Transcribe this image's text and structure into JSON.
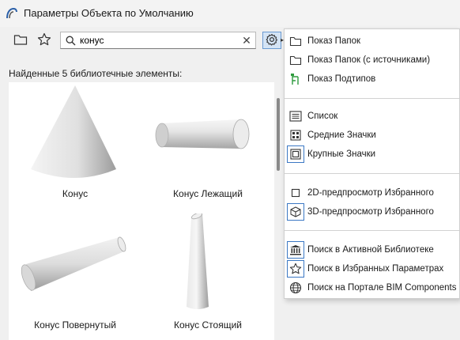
{
  "window": {
    "title": "Параметры Объекта по Умолчанию"
  },
  "toolbar": {
    "folder_icon": "folder-icon",
    "favorites_icon": "star-icon",
    "settings_icon": "gear-icon"
  },
  "search": {
    "value": "конус",
    "placeholder": "",
    "clear_label": "✕"
  },
  "results": {
    "found_label": "Найденные 5 библиотечные элементы:",
    "items": [
      {
        "label": "Конус"
      },
      {
        "label": "Конус Лежащий"
      },
      {
        "label": "Конус Повернутый"
      },
      {
        "label": "Конус Стоящий"
      }
    ]
  },
  "menu": {
    "items": [
      {
        "label": "Показ Папок",
        "icon": "folder-icon",
        "boxed": false
      },
      {
        "label": "Показ Папок (с источниками)",
        "icon": "folder-source-icon",
        "boxed": false
      },
      {
        "label": "Показ Подтипов",
        "icon": "subtype-tree-icon",
        "boxed": false
      },
      {
        "label": "Список",
        "icon": "list-icon",
        "boxed": false
      },
      {
        "label": "Средние Значки",
        "icon": "medium-icons-icon",
        "boxed": false
      },
      {
        "label": "Крупные Значки",
        "icon": "large-icons-icon",
        "boxed": true
      },
      {
        "label": "2D-предпросмотр Избранного",
        "icon": "square-2d-icon",
        "boxed": false
      },
      {
        "label": "3D-предпросмотр Избранного",
        "icon": "cube-3d-icon",
        "boxed": true
      },
      {
        "label": "Поиск в Активной Библиотеке",
        "icon": "library-icon",
        "boxed": true
      },
      {
        "label": "Поиск в Избранных Параметрах",
        "icon": "star-icon",
        "boxed": true
      },
      {
        "label": "Поиск на Портале BIM Components",
        "icon": "globe-icon",
        "boxed": false
      }
    ]
  },
  "colors": {
    "accent": "#3b78c4",
    "subtype_icon": "#2e9b3e",
    "selected_bg": "#d4e4f5"
  }
}
